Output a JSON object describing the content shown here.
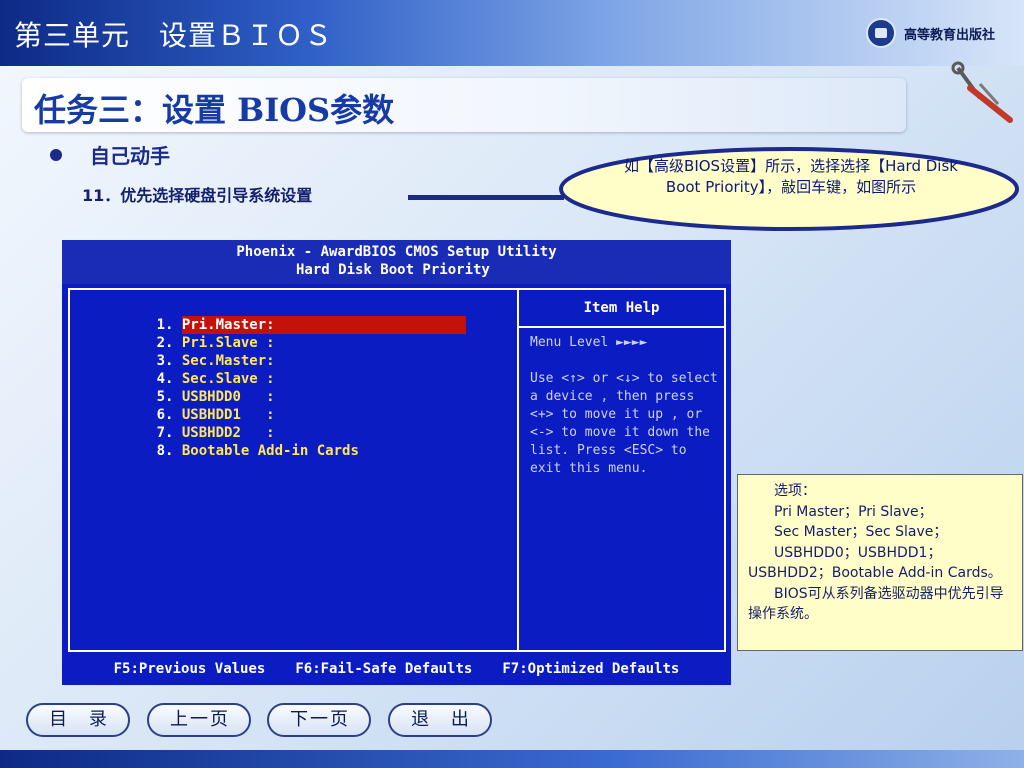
{
  "header": {
    "unit_title": "第三单元　设置ＢＩＯＳ",
    "publisher": "高等教育出版社"
  },
  "task": {
    "title": "任务三：设置 BIOS参数"
  },
  "content": {
    "bullet_title": "自己动手",
    "step": "11．优先选择硬盘引导系统设置",
    "callout_text": "如【高级BIOS设置】所示，选择选择【Hard Disk Boot Priority】，敲回车键，如图所示"
  },
  "bios": {
    "header_line1": "Phoenix - AwardBIOS CMOS Setup Utility",
    "header_line2": "Hard Disk Boot Priority",
    "boot_items": [
      {
        "num": "1.",
        "label": "Pri.Master:"
      },
      {
        "num": "2.",
        "label": "Pri.Slave :"
      },
      {
        "num": "3.",
        "label": "Sec.Master:"
      },
      {
        "num": "4.",
        "label": "Sec.Slave :"
      },
      {
        "num": "5.",
        "label": "USBHDD0   :"
      },
      {
        "num": "6.",
        "label": "USBHDD1   :"
      },
      {
        "num": "7.",
        "label": "USBHDD2   :"
      },
      {
        "num": "8.",
        "label": "Bootable Add-in Cards"
      }
    ],
    "help_title": "Item Help",
    "menu_level": "Menu Level   ►►►►",
    "help_text": "Use <↑> or <↓> to select a device , then press <+> to move it up , or <-> to move it down the list. Press <ESC> to exit this menu.",
    "footer": {
      "f5": "F5:Previous Values",
      "f6": "F6:Fail-Safe Defaults",
      "f7": "F7:Optimized Defaults"
    }
  },
  "note": {
    "line1": "选项：",
    "line2": "Pri Master；Pri Slave；",
    "line3": "Sec Master；Sec Slave；",
    "line4": "USBHDD0；USBHDD1；",
    "line5": "USBHDD2；Bootable Add-in Cards。",
    "line6": "BIOS可从系列备选驱动器中优先引导操作系统。"
  },
  "nav": {
    "contents": "目 录",
    "prev": "上一页",
    "next": "下一页",
    "exit": "退 出"
  }
}
